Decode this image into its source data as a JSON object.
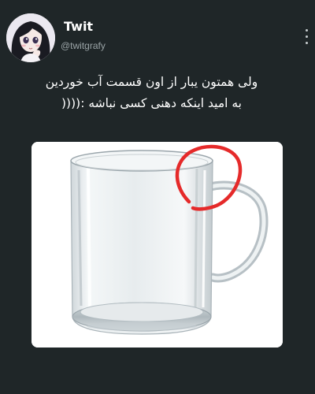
{
  "tweet": {
    "author": {
      "display_name": "Twit",
      "handle": "@twitgrafy",
      "avatar": "anime-girl-avatar"
    },
    "text_lines": [
      "ولی همتون یبار از اون قسمت آب خوردین",
      "به امید اینکه دهنی کسی نباشه :(((("
    ],
    "more_icon": "vertical-ellipsis-icon",
    "media": {
      "subject": "glass-mug",
      "annotation": "red-circle-annotation"
    }
  },
  "colors": {
    "background": "#1f2628",
    "text": "#ffffff",
    "handle": "#9aa3a6",
    "annotation": "#e52a2a"
  }
}
